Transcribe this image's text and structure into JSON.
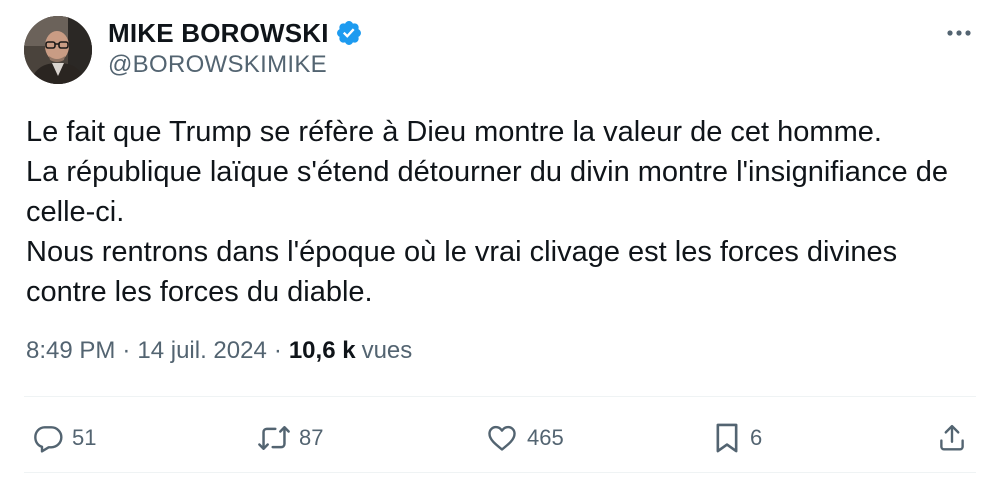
{
  "author": {
    "display_name": "MIKE BOROWSKI",
    "handle": "@BOROWSKIMIKE",
    "verified_icon": "verified-badge-icon",
    "badge_color": "#1d9bf0"
  },
  "tweet": {
    "lines": [
      "Le fait que Trump se réfère à Dieu montre la valeur de cet homme.",
      "La république laïque s'étend détourner du divin montre l'insignifiance de",
      "celle-ci.",
      "Nous rentrons dans l'époque où le vrai clivage est les forces divines",
      "contre les forces du diable."
    ],
    "time": "8:49 PM",
    "date": "14 juil. 2024",
    "separator": "·",
    "views_count": "10,6 k",
    "views_label": "vues"
  },
  "actions": {
    "replies": "51",
    "reposts": "87",
    "likes": "465",
    "bookmarks": "6"
  }
}
